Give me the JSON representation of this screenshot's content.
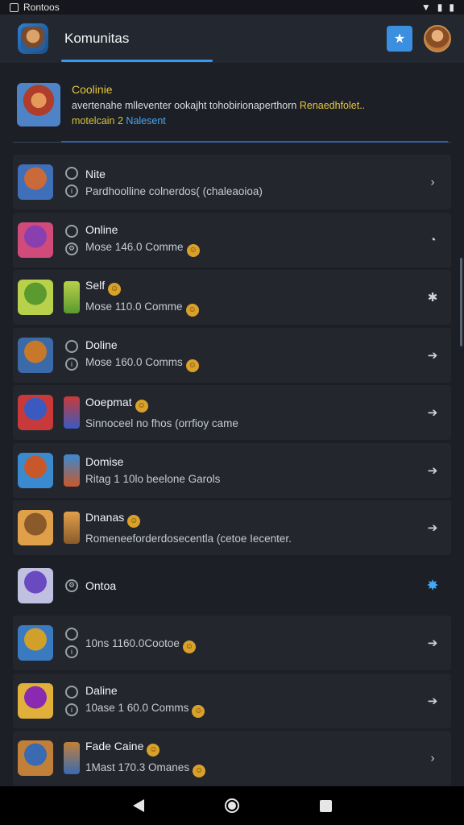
{
  "status_bar": {
    "app_name": "Rontoos"
  },
  "header": {
    "title": "Komunitas"
  },
  "featured": {
    "title": "Coolinie",
    "desc": "avertenahe mlleventer ookajht tohobirionaperthorn",
    "desc_highlight": "Renaedhfolet..",
    "tag1": "motelcain 2",
    "tag2": "Nalesent"
  },
  "rows": [
    {
      "title": "Nite",
      "sub": "Pardhoolline colnerdos( (chaleaoioa)",
      "colors": [
        "#c86a3a",
        "#3f6fb8"
      ]
    },
    {
      "title": "Online",
      "sub": "Mose 146.0 Comme",
      "colors": [
        "#8a3fb0",
        "#d04a7a"
      ]
    },
    {
      "title": "Self",
      "sub": "Mose 110.0 Comme",
      "colors": [
        "#5a9a2f",
        "#b8d04a"
      ]
    },
    {
      "title": "Doline",
      "sub": "Mose 160.0 Comms",
      "colors": [
        "#c8782a",
        "#3a6aa8"
      ]
    },
    {
      "title": "Ooepmat",
      "sub": "Sinnoceel no fhos (orrfioy came",
      "colors": [
        "#3a5ac0",
        "#c83a3a"
      ]
    },
    {
      "title": "Domise",
      "sub": "Ritag 1 10lo beelone Garols",
      "colors": [
        "#c8582a",
        "#3a8ad0"
      ]
    },
    {
      "title": "Dnanas",
      "sub": "Romeneeforderdosecentla (cetoe Iecenter.",
      "colors": [
        "#8a5a2a",
        "#e0a04a"
      ]
    },
    {
      "title": "Ontoa",
      "sub": "",
      "colors": [
        "#6a4ac0",
        "#c0c0e0"
      ]
    },
    {
      "title": "",
      "sub": "10ns 1160.0Cootoe",
      "colors": [
        "#d0a02a",
        "#3a7ac0"
      ]
    },
    {
      "title": "Daline",
      "sub": "10ase 1 60.0 Comms",
      "colors": [
        "#8a2ab0",
        "#e0b03a"
      ]
    },
    {
      "title": "Fade Caine",
      "sub": "1Mast 170.3 Omanes",
      "colors": [
        "#3a6ab0",
        "#c0803a"
      ]
    }
  ]
}
